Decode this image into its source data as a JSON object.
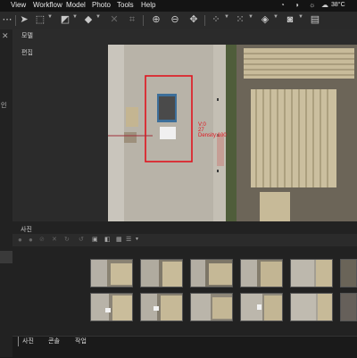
{
  "menu": {
    "items": [
      "View",
      "Workflow",
      "Model",
      "Photo",
      "Tools",
      "Help"
    ],
    "status_temp": "38°C"
  },
  "panels": {
    "model_title": "모델",
    "model_item": "편집",
    "left_edge_label": "인",
    "photos_title": "사진"
  },
  "viewport": {
    "annotation_lines": [
      "V:0",
      "27",
      "Density:100"
    ],
    "box_color": "#e0141e",
    "label_color": "#e0141e"
  },
  "thumbnails": {
    "row1_count": 6,
    "row2_count": 6
  },
  "tabs": [
    "사진",
    "콘솔",
    "작업"
  ]
}
